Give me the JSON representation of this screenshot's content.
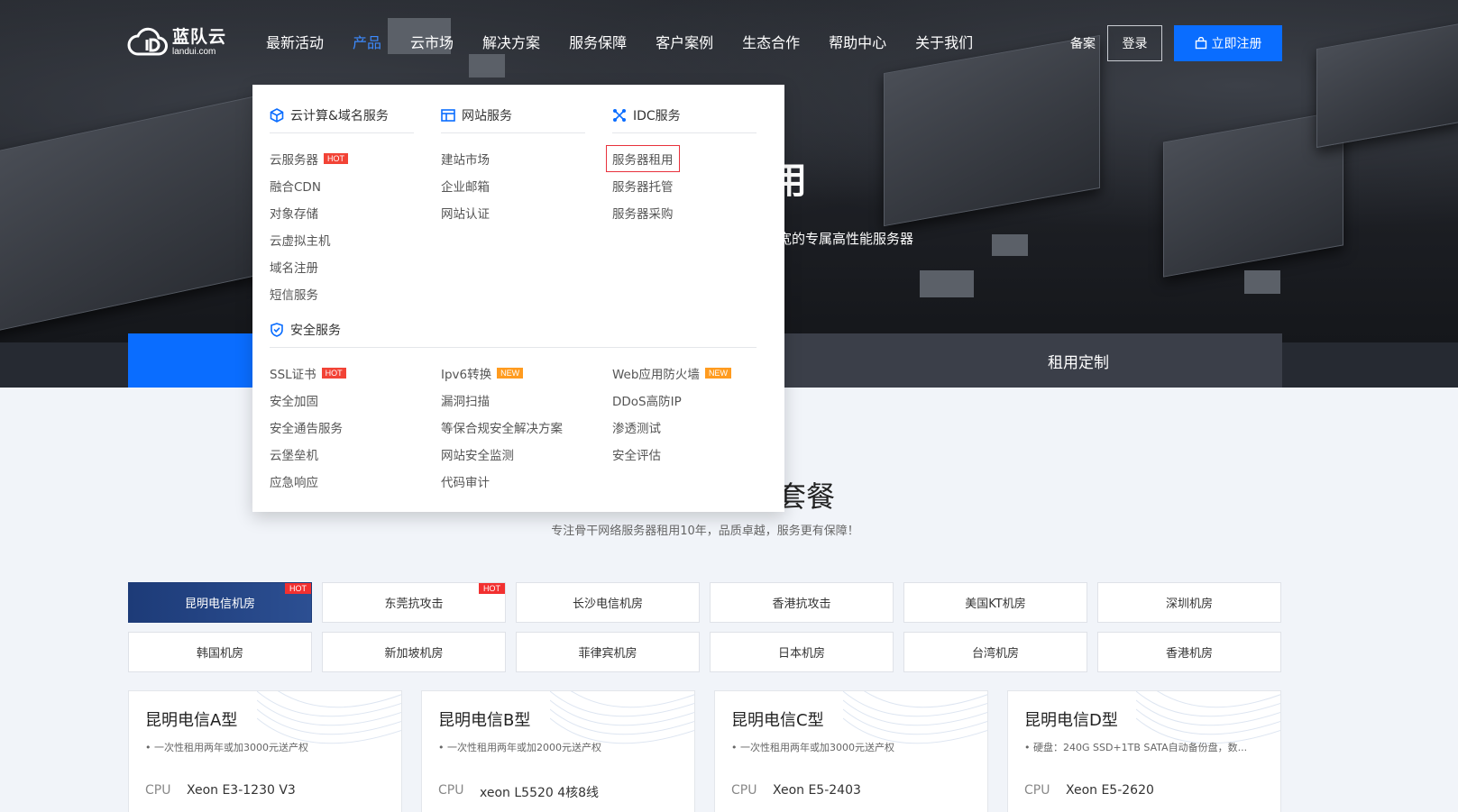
{
  "brand": {
    "name": "蓝队云",
    "domain": "landui.com"
  },
  "nav": [
    "最新活动",
    "产品",
    "云市场",
    "解决方案",
    "服务保障",
    "客户案例",
    "生态合作",
    "帮助中心",
    "关于我们"
  ],
  "nav_active_index": 1,
  "header": {
    "beian": "备案",
    "login": "登录",
    "register": "立即注册"
  },
  "hero": {
    "title_fragment": "用",
    "subtitle_fragment": "宽的专属高性能服务器"
  },
  "tabbar": {
    "right_label": "租用定制"
  },
  "dropdown": {
    "cloud": {
      "title": "云计算&域名服务",
      "items": [
        "云服务器",
        "融合CDN",
        "对象存储",
        "云虚拟主机",
        "域名注册",
        "短信服务"
      ],
      "hot_index": 0
    },
    "website": {
      "title": "网站服务",
      "items": [
        "建站市场",
        "企业邮箱",
        "网站认证"
      ]
    },
    "idc": {
      "title": "IDC服务",
      "items": [
        "服务器租用",
        "服务器托管",
        "服务器采购"
      ],
      "highlight_index": 0
    },
    "security": {
      "title": "安全服务",
      "col1": [
        "SSL证书",
        "安全加固",
        "安全通告服务",
        "云堡垒机",
        "应急响应"
      ],
      "col2": [
        "Ipv6转换",
        "漏洞扫描",
        "等保合规安全解决方案",
        "网站安全监测",
        "代码审计"
      ],
      "col3": [
        "Web应用防火墙",
        "DDoS高防IP",
        "渗透测试",
        "安全评估"
      ]
    },
    "tags": {
      "hot": "HOT",
      "new": "NEW"
    }
  },
  "section": {
    "title_fragment": "套餐",
    "subtitle": "专注骨干网络服务器租用10年，品质卓越，服务更有保障！"
  },
  "rooms": [
    {
      "name": "昆明电信机房",
      "hot": true,
      "active": true
    },
    {
      "name": "东莞抗攻击",
      "hot": true
    },
    {
      "name": "长沙电信机房"
    },
    {
      "name": "香港抗攻击"
    },
    {
      "name": "美国KT机房"
    },
    {
      "name": "深圳机房"
    },
    {
      "name": "韩国机房"
    },
    {
      "name": "新加坡机房"
    },
    {
      "name": "菲律宾机房"
    },
    {
      "name": "日本机房"
    },
    {
      "name": "台湾机房"
    },
    {
      "name": "香港机房"
    }
  ],
  "room_hot_label": "HOT",
  "cards": [
    {
      "title": "昆明电信A型",
      "note": "• 一次性租用两年或加3000元送产权",
      "cpu_label": "CPU",
      "cpu": "Xeon E3-1230 V3"
    },
    {
      "title": "昆明电信B型",
      "note": "• 一次性租用两年或加2000元送产权",
      "cpu_label": "CPU",
      "cpu": "xeon L5520 4核8线"
    },
    {
      "title": "昆明电信C型",
      "note": "• 一次性租用两年或加3000元送产权",
      "cpu_label": "CPU",
      "cpu": "Xeon E5-2403"
    },
    {
      "title": "昆明电信D型",
      "note": "• 硬盘：240G SSD+1TB SATA自动备份盘，数...",
      "cpu_label": "CPU",
      "cpu": "Xeon E5-2620"
    }
  ],
  "colors": {
    "primary": "#0a6dff",
    "hot": "#f24336",
    "new": "#ff9b1f",
    "nav_active": "#3d8bff"
  }
}
